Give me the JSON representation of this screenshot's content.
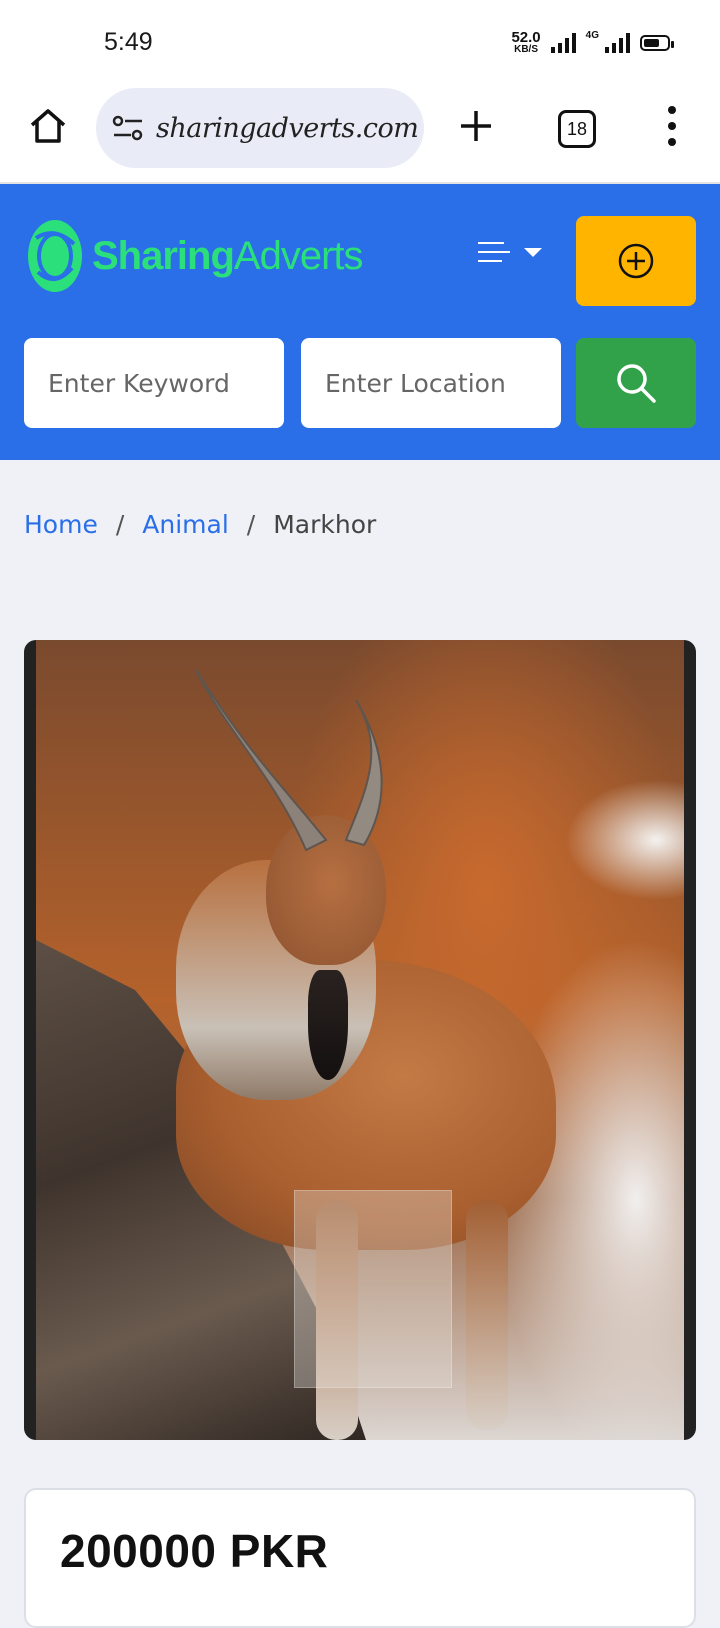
{
  "status_bar": {
    "time": "5:49",
    "net_speed": "52.0",
    "net_unit": "KB/S",
    "network_type": "4G"
  },
  "browser": {
    "url": "sharingadverts.com",
    "tab_count": "18",
    "icons": [
      "home-icon",
      "site-settings-icon",
      "new-tab-plus-icon",
      "tab-switcher-icon",
      "overflow-menu-icon"
    ]
  },
  "site": {
    "logo": {
      "part1": "Sharing",
      "part2": "Adverts"
    },
    "colors": {
      "header_bg": "#2a6fe8",
      "logo_green": "#2be07a",
      "post_button": "#ffb400",
      "search_button": "#32a24a"
    },
    "search": {
      "keyword_placeholder": "Enter Keyword",
      "location_placeholder": "Enter Location"
    }
  },
  "breadcrumb": {
    "items": [
      {
        "label": "Home"
      },
      {
        "label": "Animal"
      },
      {
        "label": "Markhor"
      }
    ],
    "separator": "/"
  },
  "listing": {
    "price": "200000 PKR"
  }
}
